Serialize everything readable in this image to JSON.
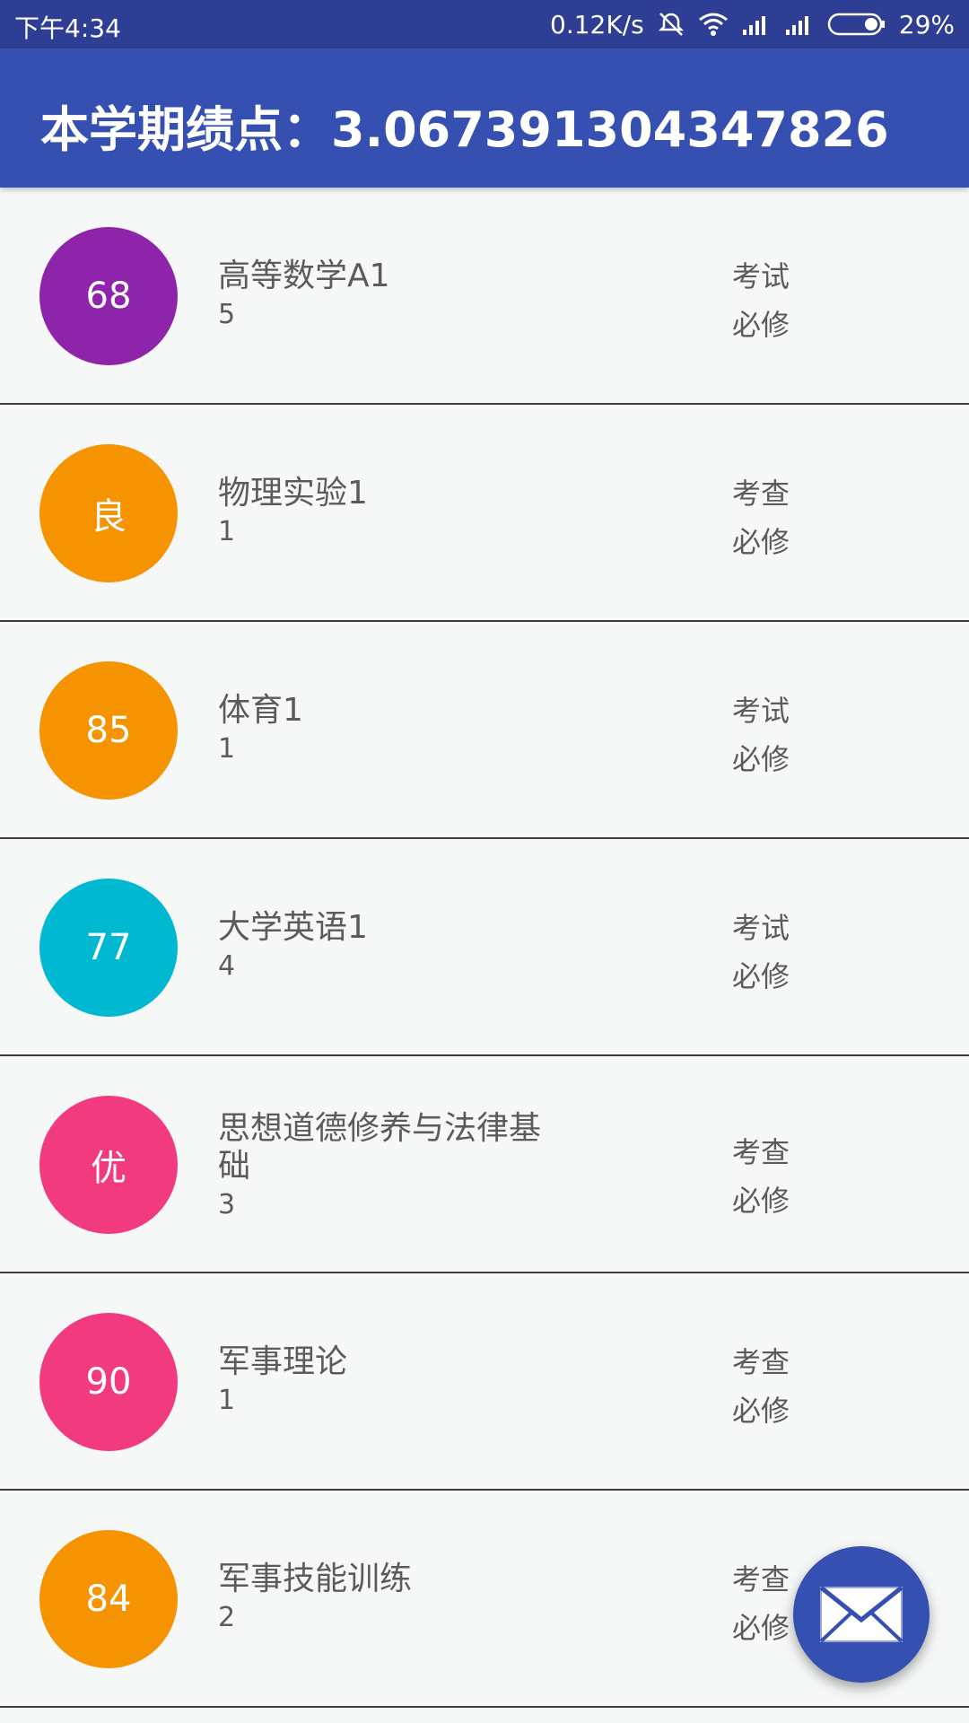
{
  "status_bar": {
    "time": "下午4:34",
    "net_speed": "0.12K/s",
    "battery": "29%",
    "icons": [
      "mute-vibrate-icon",
      "wifi-icon",
      "signal-icon",
      "signal-icon",
      "battery-icon"
    ]
  },
  "app_bar": {
    "title": "本学期绩点：3.067391304347826"
  },
  "courses": [
    {
      "grade": "68",
      "name": "高等数学A1",
      "credit": "5",
      "assessment": "考试",
      "type": "必修",
      "color": "#8e24aa"
    },
    {
      "grade": "良",
      "name": "物理实验1",
      "credit": "1",
      "assessment": "考查",
      "type": "必修",
      "color": "#f59300"
    },
    {
      "grade": "85",
      "name": "体育1",
      "credit": "1",
      "assessment": "考试",
      "type": "必修",
      "color": "#f59300"
    },
    {
      "grade": "77",
      "name": "大学英语1",
      "credit": "4",
      "assessment": "考试",
      "type": "必修",
      "color": "#00b8d0"
    },
    {
      "grade": "优",
      "name": "思想道德修养与法律基础",
      "credit": "3",
      "assessment": "考查",
      "type": "必修",
      "color": "#f23b7e"
    },
    {
      "grade": "90",
      "name": "军事理论",
      "credit": "1",
      "assessment": "考查",
      "type": "必修",
      "color": "#f23b7e"
    },
    {
      "grade": "84",
      "name": "军事技能训练",
      "credit": "2",
      "assessment": "考查",
      "type": "必修",
      "color": "#f59300"
    }
  ],
  "fab": {
    "icon": "mail-icon"
  }
}
